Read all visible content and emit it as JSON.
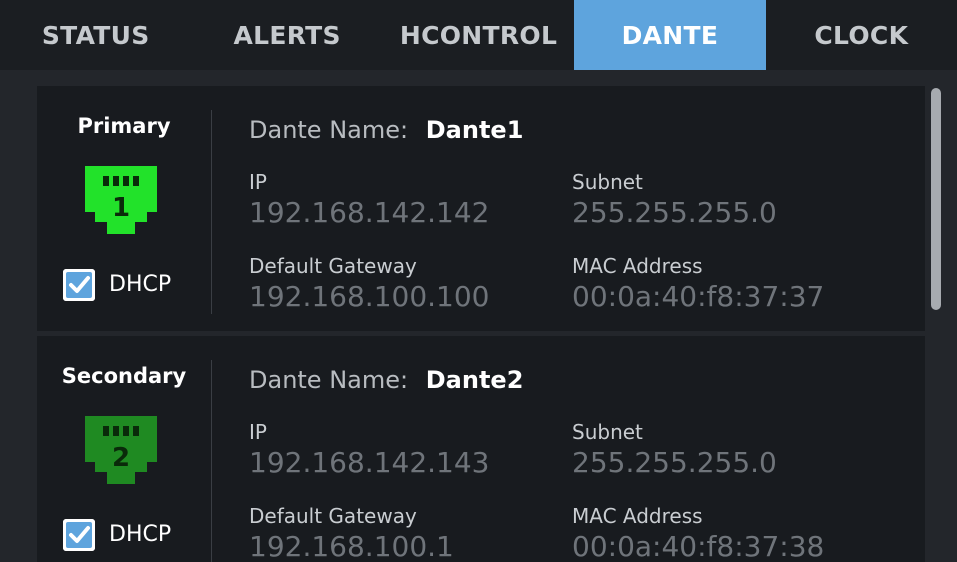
{
  "tabs": [
    {
      "label": "STATUS",
      "active": false
    },
    {
      "label": "ALERTS",
      "active": false
    },
    {
      "label": "HCONTROL",
      "active": false
    },
    {
      "label": "DANTE",
      "active": true
    },
    {
      "label": "CLOCK",
      "active": false
    }
  ],
  "colors": {
    "accent": "#5ea4dd",
    "primary_port": "#22e22a",
    "secondary_port": "#1f8a22"
  },
  "primary": {
    "title": "Primary",
    "port_number": "1",
    "port_icon": "ethernet-port-icon",
    "dhcp_checked": true,
    "dhcp_label": "DHCP",
    "dante_name_label": "Dante Name:",
    "dante_name": "Dante1",
    "ip_label": "IP",
    "ip": "192.168.142.142",
    "subnet_label": "Subnet",
    "subnet": "255.255.255.0",
    "gateway_label": "Default Gateway",
    "gateway": "192.168.100.100",
    "mac_label": "MAC Address",
    "mac": "00:0a:40:f8:37:37"
  },
  "secondary": {
    "title": "Secondary",
    "port_number": "2",
    "port_icon": "ethernet-port-icon",
    "dhcp_checked": true,
    "dhcp_label": "DHCP",
    "dante_name_label": "Dante Name:",
    "dante_name": "Dante2",
    "ip_label": "IP",
    "ip": "192.168.142.143",
    "subnet_label": "Subnet",
    "subnet": "255.255.255.0",
    "gateway_label": "Default Gateway",
    "gateway": "192.168.100.1",
    "mac_label": "MAC Address",
    "mac": "00:0a:40:f8:37:38"
  }
}
